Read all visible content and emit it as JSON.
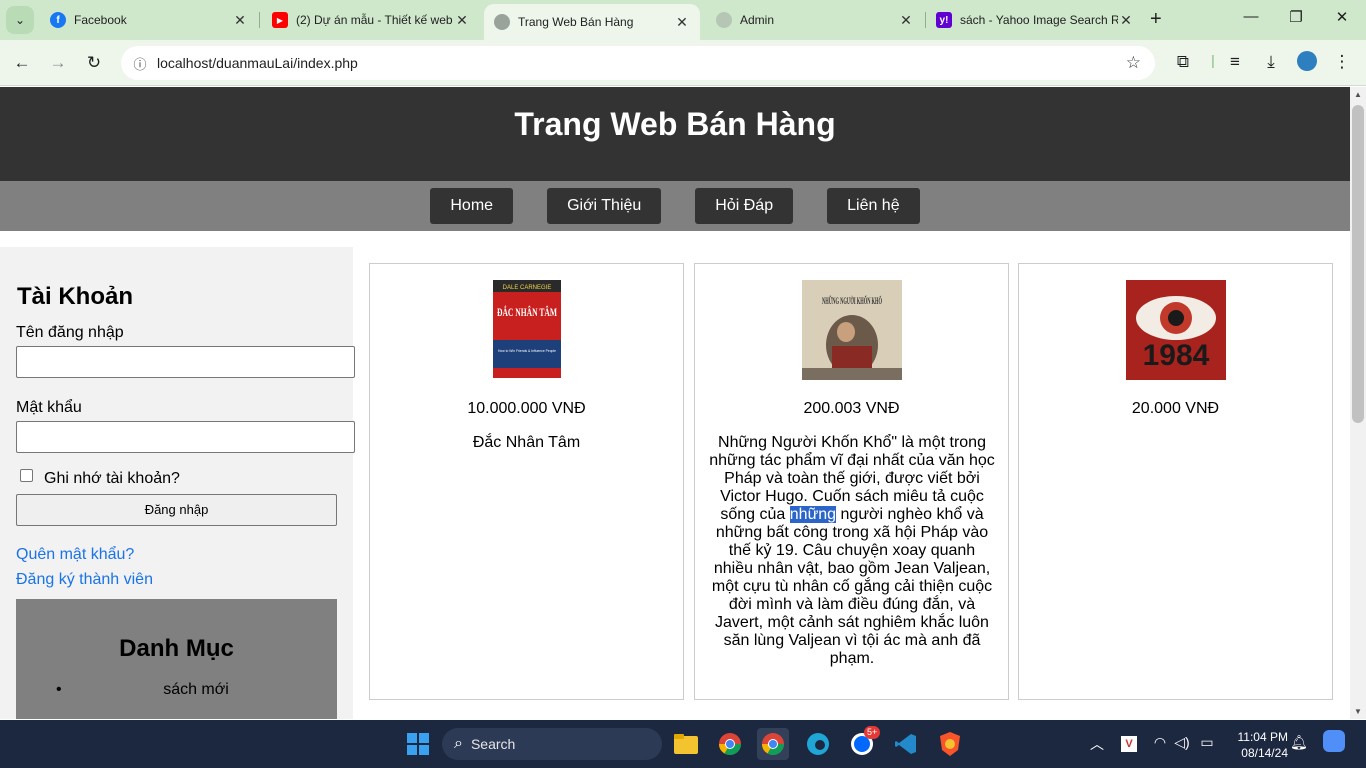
{
  "browser": {
    "tabs": [
      {
        "title": "Facebook",
        "icon": "facebook-icon",
        "active": false
      },
      {
        "title": "(2) Dự án mẫu - Thiết kế web",
        "icon": "youtube-icon",
        "active": false
      },
      {
        "title": "Trang Web Bán Hàng",
        "icon": "globe-icon",
        "active": true
      },
      {
        "title": "Admin",
        "icon": "globe-icon",
        "active": false
      },
      {
        "title": "sách - Yahoo Image Search R",
        "icon": "yahoo-icon",
        "active": false
      }
    ],
    "url": "localhost/duanmauLai/index.php"
  },
  "site": {
    "title": "Trang Web Bán Hàng",
    "nav": [
      "Home",
      "Giới Thiệu",
      "Hỏi Đáp",
      "Liên hệ"
    ]
  },
  "account": {
    "heading": "Tài Khoản",
    "username_label": "Tên đăng nhập",
    "password_label": "Mật khẩu",
    "remember_label": "Ghi nhớ tài khoản?",
    "login_button": "Đăng nhập",
    "forgot_link": "Quên mật khẩu?",
    "register_link": "Đăng ký thành viên"
  },
  "category": {
    "heading": "Danh Mục",
    "items": [
      "sách mới"
    ]
  },
  "products": [
    {
      "cover_title": "ĐẮC NHÂN TÂM",
      "cover_author": "DALE CARNEGIE",
      "cover_subtitle": "How to Win Friends & Influence People",
      "price": "10.000.000 VNĐ",
      "name": "Đắc Nhân Tâm",
      "colors": {
        "cover": "#c8201f"
      }
    },
    {
      "cover_title": "NHỮNG NGƯỜI KHỐN KHỔ",
      "price": "200.003 VNĐ",
      "description_before": "Những Người Khốn Khổ\" là một trong những tác phẩm vĩ đại nhất của văn học Pháp và toàn thế giới, được viết bởi Victor Hugo. Cuốn sách miêu tả cuộc sống của ",
      "description_highlight": "những",
      "description_after": " người nghèo khổ và những bất công trong xã hội Pháp vào thế kỷ 19. Câu chuyện xoay quanh nhiều nhân vật, bao gồm Jean Valjean, một cựu tù nhân cố gắng cải thiện cuộc đời mình và làm điều đúng đắn, và Javert, một cảnh sát nghiêm khắc luôn săn lùng Valjean vì tội ác mà anh đã phạm."
    },
    {
      "cover_title": "1984",
      "price": "20.000 VNĐ",
      "colors": {
        "cover": "#a8231e"
      }
    }
  ],
  "taskbar": {
    "search_placeholder": "Search",
    "time": "11:04 PM",
    "date": "08/14/24",
    "zalo_badge": "5+"
  },
  "colors": {
    "header_bg": "#333333",
    "nav_bg": "#808080",
    "link": "#1a73e8",
    "tabbar_bg": "#cfe8cc"
  }
}
